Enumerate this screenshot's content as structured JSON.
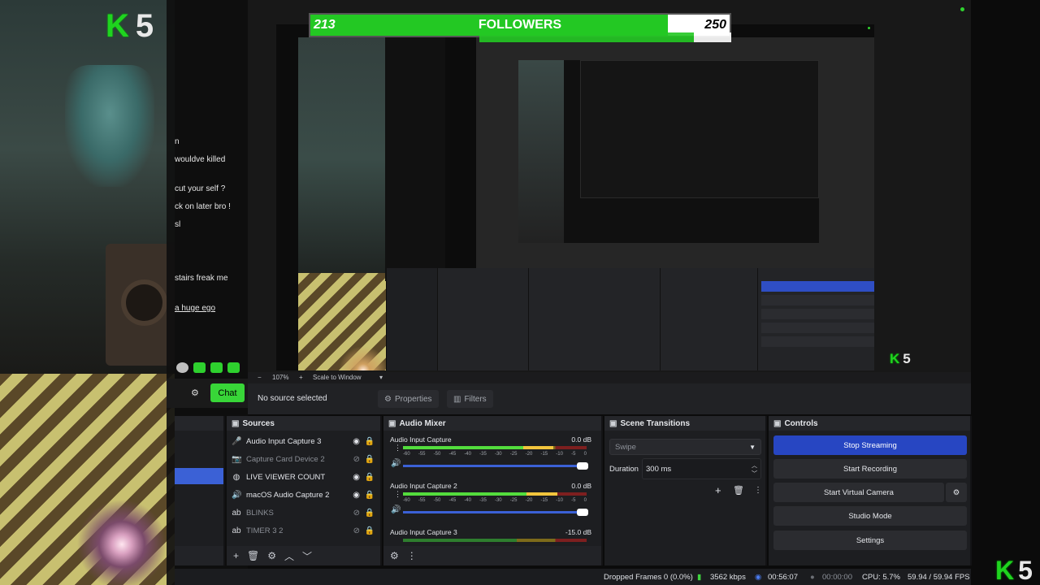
{
  "overlay": {
    "k5_k": "K",
    "k5_n": "5",
    "followers_current": "213",
    "followers_label": "FOLLOWERS",
    "followers_goal": "250",
    "followers_progress": 0.852,
    "chat_lines": [
      "n",
      "wouldve killed",
      "cut your self ?",
      "ck on later bro !",
      "sl",
      "stairs freak me",
      "a huge ego"
    ],
    "chat_button": "Chat",
    "accent_green": "#23c823"
  },
  "zoombar": {
    "minus": "−",
    "zoom": "107%",
    "plus": "+",
    "mode": "Scale to Window",
    "caret": "▾"
  },
  "context": {
    "no_source": "No source selected",
    "properties": "Properties",
    "filters": "Filters"
  },
  "sources": {
    "title": "Sources",
    "items": [
      {
        "label": "Audio Input Capture 3",
        "icon": "microphone-icon",
        "glyph": "🎤",
        "visible": true,
        "locked": true
      },
      {
        "label": "Capture Card Device 2",
        "icon": "camera-icon",
        "glyph": "📷",
        "visible": false,
        "locked": true
      },
      {
        "label": "LIVE VIEWER COUNT",
        "icon": "globe-icon",
        "glyph": "◍",
        "visible": true,
        "locked": true
      },
      {
        "label": "macOS Audio Capture 2",
        "icon": "speaker-icon",
        "glyph": "🔊",
        "visible": true,
        "locked": true
      },
      {
        "label": "BLINKS",
        "icon": "text-icon",
        "glyph": "ab",
        "visible": false,
        "locked": true
      },
      {
        "label": "TIMER 3 2",
        "icon": "text-icon",
        "glyph": "ab",
        "visible": false,
        "locked": true
      }
    ],
    "footer": {
      "add": "+",
      "remove": "🗑",
      "settings": "⚙",
      "up": "︿",
      "down": "﹀"
    }
  },
  "audio_mixer": {
    "title": "Audio Mixer",
    "scale": [
      "-60",
      "-55",
      "-50",
      "-45",
      "-40",
      "-35",
      "-30",
      "-25",
      "-20",
      "-15",
      "-10",
      "-5",
      "0"
    ],
    "channels": [
      {
        "name": "Audio Input Capture",
        "db": "0.0 dB",
        "level": 0.82,
        "volume": 1.0
      },
      {
        "name": "Audio Input Capture 2",
        "db": "0.0 dB",
        "level": 0.84,
        "volume": 1.0
      },
      {
        "name": "Audio Input Capture 3",
        "db": "-15.0 dB",
        "level": 0.0,
        "volume": 0.75
      }
    ]
  },
  "scene_transitions": {
    "title": "Scene Transitions",
    "transition": "Swipe",
    "duration_label": "Duration",
    "duration": "300 ms"
  },
  "controls": {
    "title": "Controls",
    "buttons": [
      "Stop Streaming",
      "Start Recording",
      "Start Virtual Camera",
      "Studio Mode",
      "Settings"
    ]
  },
  "status": {
    "dropped_frames": "Dropped Frames 0 (0.0%)",
    "bitrate": "3562 kbps",
    "stream_time": "00:56:07",
    "rec_time": "00:00:00",
    "cpu": "CPU: 5.7%",
    "fps": "59.94 / 59.94 FPS"
  }
}
